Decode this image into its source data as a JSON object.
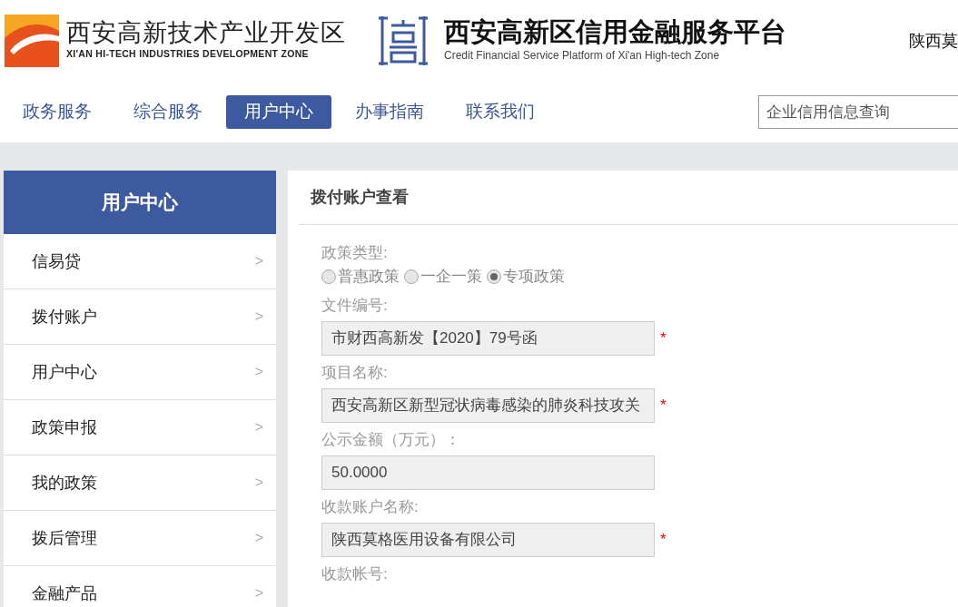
{
  "header": {
    "zone_logo": {
      "title": "西安高新技术产业开发区",
      "subtitle": "XI'AN HI-TECH INDUSTRIES DEVELOPMENT ZONE"
    },
    "platform_logo": {
      "title": "西安高新区信用金融服务平台",
      "subtitle": "Credit Financial Service Platform of Xi'an High-tech Zone"
    },
    "user": "陕西莫"
  },
  "nav": [
    {
      "label": "政务服务",
      "selected": false
    },
    {
      "label": "综合服务",
      "selected": false
    },
    {
      "label": "用户中心",
      "selected": true
    },
    {
      "label": "办事指南",
      "selected": false
    },
    {
      "label": "联系我们",
      "selected": false
    }
  ],
  "search": {
    "placeholder": "企业信用信息查询"
  },
  "sidebar": {
    "title": "用户中心",
    "items": [
      {
        "label": "信易贷",
        "arrow": ">"
      },
      {
        "label": "拨付账户",
        "arrow": ">"
      },
      {
        "label": "用户中心",
        "arrow": ">"
      },
      {
        "label": "政策申报",
        "arrow": ">"
      },
      {
        "label": "我的政策",
        "arrow": ">"
      },
      {
        "label": "拨后管理",
        "arrow": ">"
      },
      {
        "label": "金融产品",
        "arrow": ">"
      }
    ]
  },
  "panel": {
    "title": "拨付账户查看",
    "policy_type": {
      "label": "政策类型:",
      "options": [
        {
          "label": "普惠政策",
          "selected": false
        },
        {
          "label": "一企一策",
          "selected": false
        },
        {
          "label": "专项政策",
          "selected": true
        }
      ]
    },
    "fields": [
      {
        "label": "文件编号:",
        "value": "市财西高新发【2020】79号函",
        "required_mark": "*"
      },
      {
        "label": "项目名称:",
        "value": "西安高新区新型冠状病毒感染的肺炎科技攻关",
        "required_mark": "*"
      },
      {
        "label": "公示金额（万元）：",
        "value": "50.0000"
      },
      {
        "label": "收款账户名称:",
        "value": "陕西莫格医用设备有限公司",
        "required_mark": "*"
      }
    ],
    "trailing_label": "收款帐号:"
  }
}
